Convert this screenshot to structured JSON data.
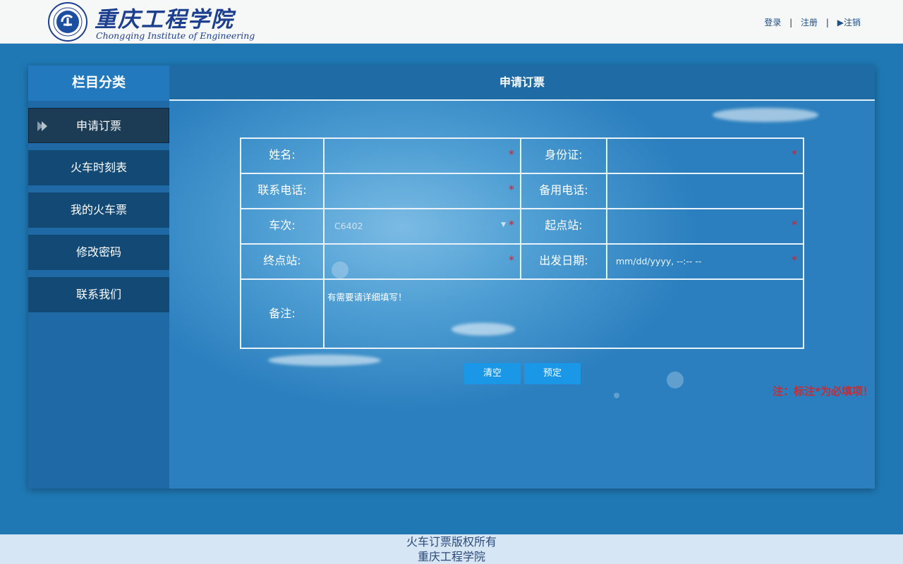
{
  "header": {
    "logo_cn": "重庆工程学院",
    "logo_en": "Chongqing Institute of Engineering",
    "logo_seal_text": "Chongqing Institute of Engineering",
    "links": {
      "login": "登录",
      "register": "注册",
      "logout": "▶注销",
      "separator": "|"
    }
  },
  "sidebar": {
    "title": "栏目分类",
    "items": [
      {
        "label": "申请订票",
        "active": true
      },
      {
        "label": "火车时刻表"
      },
      {
        "label": "我的火车票"
      },
      {
        "label": "修改密码"
      },
      {
        "label": "联系我们"
      }
    ]
  },
  "content": {
    "title": "申请订票",
    "form": {
      "name_label": "姓名:",
      "id_label": "身份证:",
      "phone_label": "联系电话:",
      "backup_phone_label": "备用电话:",
      "train_label": "车次:",
      "train_value": "C6402",
      "start_label": "起点站:",
      "end_label": "终点站:",
      "date_label": "出发日期:",
      "date_placeholder": "mm/dd/yyyy, --:-- --",
      "remark_label": "备注:",
      "remark_value": "有需要请详细填写！",
      "required_mark": "*"
    },
    "buttons": {
      "clear": "清空",
      "submit": "预定"
    },
    "note": "注：标注*为必填项！"
  },
  "footer": {
    "line1": "火车订票版权所有",
    "line2": "重庆工程学院"
  },
  "colors": {
    "background": "#1f78b4",
    "required": "#d51f2a",
    "button": "#1a97e6",
    "footer": "#d7e6f5"
  }
}
